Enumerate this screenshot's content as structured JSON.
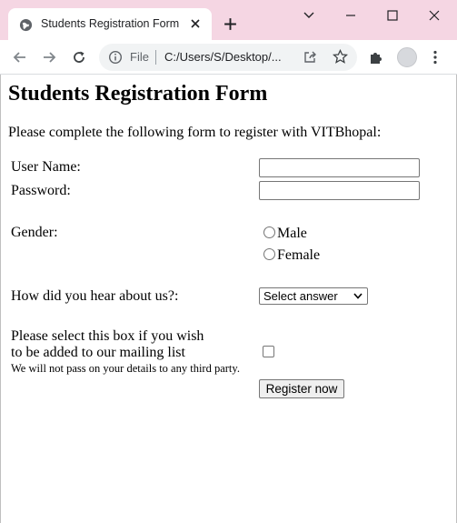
{
  "browser": {
    "tab_title": "Students Registration Form",
    "omnibox_scheme": "File",
    "omnibox_url": "C:/Users/S/Desktop/...",
    "accent_color": "#f5d6e3"
  },
  "page": {
    "title": "Students Registration Form",
    "intro": "Please complete the following form to register with VITBhopal:"
  },
  "form": {
    "username_label": "User Name:",
    "username_value": "",
    "password_label": "Password:",
    "password_value": "",
    "gender_label": "Gender:",
    "gender_options": [
      "Male",
      "Female"
    ],
    "referral_label": "How did you hear about us?:",
    "referral_selected": "Select answer",
    "mailing_line1": "Please select this box if you wish",
    "mailing_line2": "to be added to our mailing list",
    "mailing_note": "We will not pass on your details to any third party.",
    "mailing_checked": false,
    "submit_label": "Register now"
  }
}
